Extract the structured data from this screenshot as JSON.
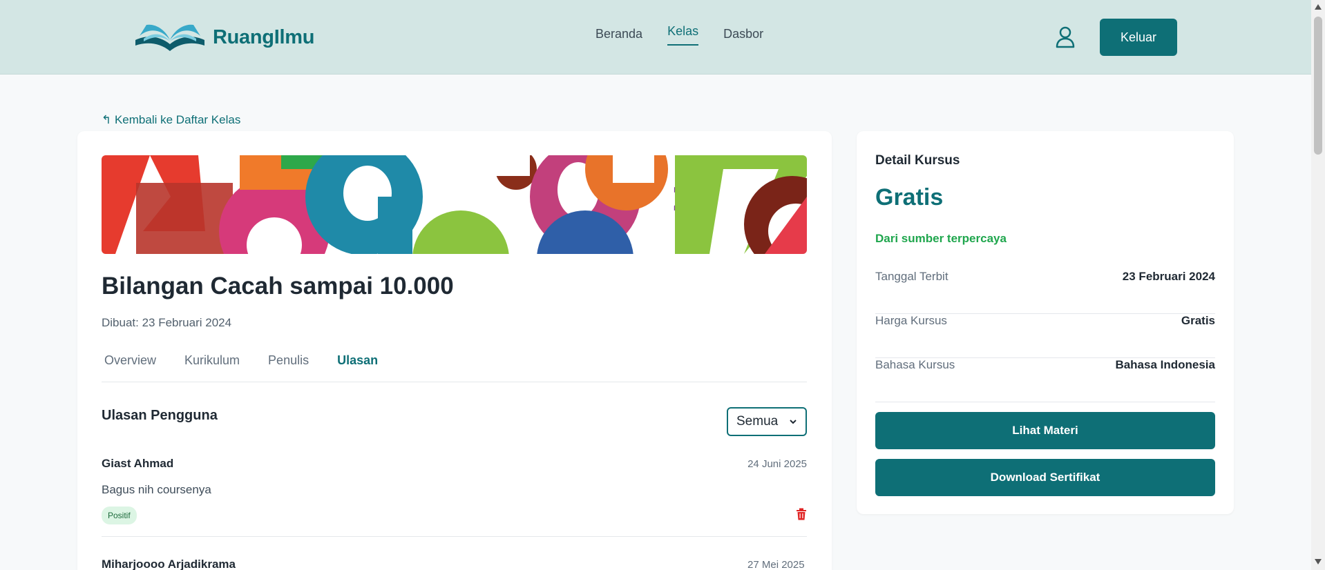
{
  "header": {
    "brand": "RuangIlmu",
    "nav": [
      {
        "label": "Beranda",
        "active": false
      },
      {
        "label": "Kelas",
        "active": true
      },
      {
        "label": "Dasbor",
        "active": false
      }
    ],
    "logout_label": "Keluar",
    "accent_color": "#0e6f76",
    "header_bg": "#d3e6e4"
  },
  "back_link": "↰ Kembali ke Daftar Kelas",
  "course": {
    "title": "Bilangan Cacah sampai 10.000",
    "created": "Dibuat: 23 Februari 2024",
    "tabs": [
      {
        "label": "Overview",
        "active": false
      },
      {
        "label": "Kurikulum",
        "active": false
      },
      {
        "label": "Penulis",
        "active": false
      },
      {
        "label": "Ulasan",
        "active": true
      }
    ]
  },
  "reviews": {
    "title": "Ulasan Pengguna",
    "filter_value": "Semua",
    "items": [
      {
        "name": "Giast Ahmad",
        "date": "24 Juni 2025",
        "text": "Bagus nih coursenya",
        "badge": "Positif"
      },
      {
        "name": "Miharjoooo Arjadikrama",
        "date": "27 Mei 2025"
      }
    ]
  },
  "detail": {
    "heading": "Detail Kursus",
    "price": "Gratis",
    "trusted": "Dari sumber terpercaya",
    "rows": [
      {
        "key": "Tanggal Terbit",
        "value": "23 Februari 2024"
      },
      {
        "key": "Harga Kursus",
        "value": "Gratis"
      },
      {
        "key": "Bahasa Kursus",
        "value": "Bahasa Indonesia"
      }
    ],
    "view_material": "Lihat Materi",
    "download_certificate": "Download Sertifikat"
  }
}
